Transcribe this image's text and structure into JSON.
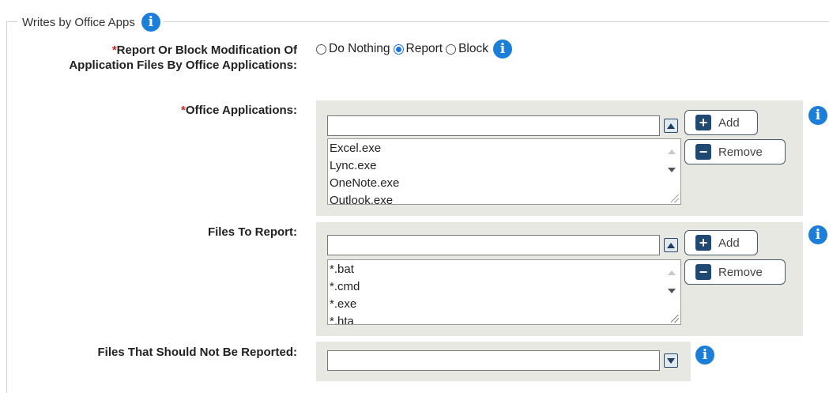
{
  "section": {
    "legend": "Writes by Office Apps",
    "info_icon": "info-icon"
  },
  "report_or_block": {
    "required_mark": "*",
    "label": "Report Or Block Modification Of Application Files By Office Applications:",
    "options": [
      "Do Nothing",
      "Report",
      "Block"
    ],
    "selected": "Report"
  },
  "office_applications": {
    "required_mark": "*",
    "label": "Office Applications:",
    "input_value": "",
    "items": [
      "Excel.exe",
      "Lync.exe",
      "OneNote.exe",
      "Outlook.exe"
    ],
    "add_label": "Add",
    "remove_label": "Remove"
  },
  "files_to_report": {
    "label": "Files To Report:",
    "input_value": "",
    "items": [
      "*.bat",
      "*.cmd",
      "*.exe",
      "*.hta"
    ],
    "add_label": "Add",
    "remove_label": "Remove"
  },
  "files_not_reported": {
    "label": "Files That Should Not Be Reported:",
    "input_value": ""
  },
  "colors": {
    "info_blue": "#1b7ed8",
    "required_red": "#d21f1f",
    "panel_gray": "#e8e8e3",
    "button_icon_navy": "#1f4872"
  }
}
